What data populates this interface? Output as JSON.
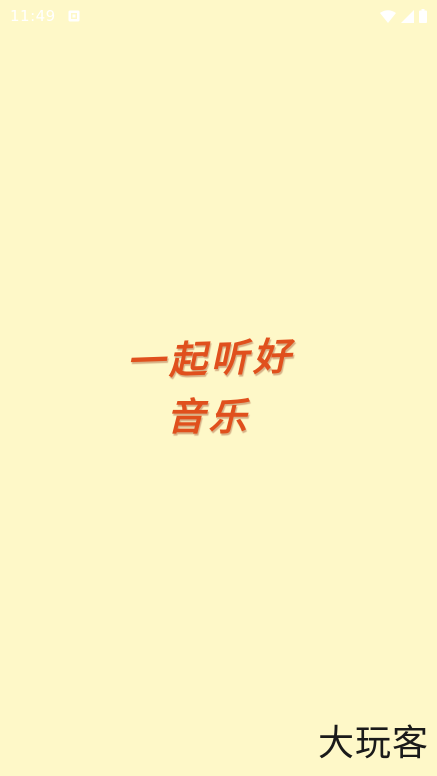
{
  "status_bar": {
    "time": "11:49",
    "icons": [
      "notification-icon",
      "wifi-icon",
      "signal-icon",
      "battery-icon"
    ]
  },
  "splash": {
    "slogan_line_1": "一起听好",
    "slogan_line_2": "音乐",
    "slogan_color": "#E0501D"
  },
  "watermark": {
    "text": "大玩客"
  },
  "colors": {
    "background": "#FEF8C8"
  }
}
